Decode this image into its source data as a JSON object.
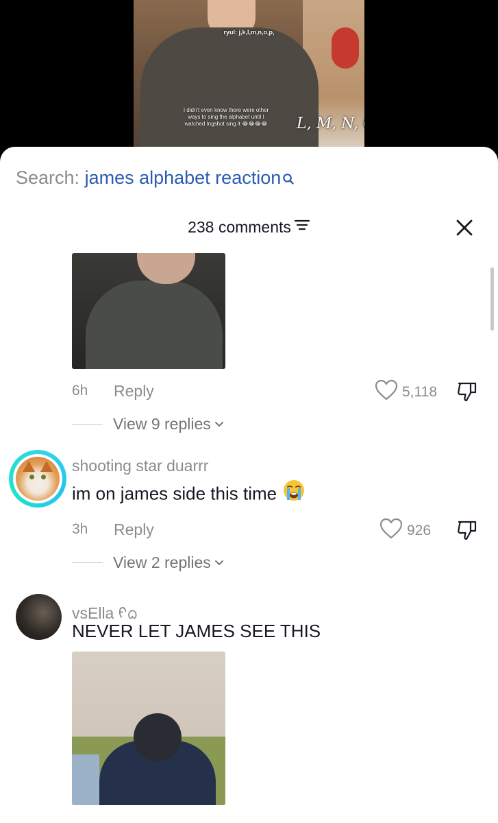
{
  "video": {
    "caption_top": "ryul: j,k,l,m,n,o,p,",
    "caption_mid": "I didn't even know there were other ways to sing the alphabet until I watched Ingshot sing it 😂😂😂😂",
    "caption_big": "L, M, N, O,"
  },
  "search": {
    "prefix": "Search: ",
    "query": "james alphabet reaction"
  },
  "header": {
    "comments_count": "238 comments"
  },
  "comments": [
    {
      "time": "6h",
      "reply_label": "Reply",
      "likes": "5,118",
      "view_replies": "View 9 replies"
    },
    {
      "username": "shooting star duarrr",
      "text": "im on james side this time",
      "time": "3h",
      "reply_label": "Reply",
      "likes": "926",
      "view_replies": "View 2 replies"
    },
    {
      "username": "vsElla",
      "username_suffix": "ᠻᨵ",
      "text": "NEVER LET JAMES SEE THIS"
    }
  ],
  "colors": {
    "link_blue": "#2b5cb0",
    "muted_gray": "#8a8b91",
    "text_dark": "#161823",
    "ring_cyan": "#2fd7e8"
  },
  "icons": [
    "search-icon",
    "sort-icon",
    "close-icon",
    "heart-icon",
    "dislike-icon",
    "chevron-down-icon",
    "crying-face-emoji"
  ]
}
